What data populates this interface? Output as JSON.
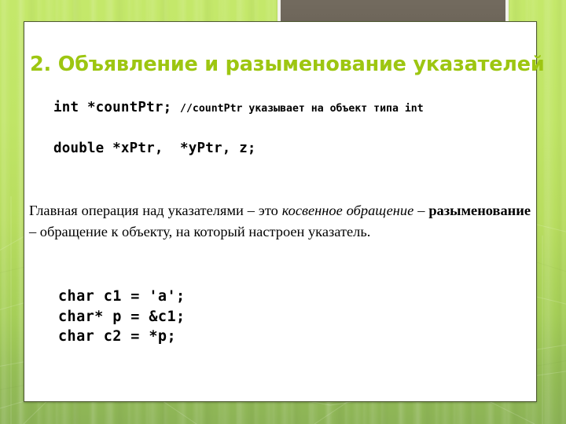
{
  "slide": {
    "title": "2. Объявление и разыменование указателей",
    "title_color": "#9dc611",
    "background_color": "#b8dd5f",
    "panel_color": "#ffffff",
    "panel_border_color": "#4f5a32",
    "photo_block_color": "#6f675b",
    "photo_frame_color": "#f2f2ec"
  },
  "code_top": {
    "line1_code": "int *countPtr; ",
    "line1_comment": "//countPtr указывает на объект типа int",
    "line2": "double *xPtr,  *yPtr, z;"
  },
  "paragraph": {
    "part1": "Главная операция над указателями – это ",
    "italic1": "косвенное обращение",
    "part2": " – ",
    "bold1": "разыменование",
    "part3": " – обращение к объекту, на который настроен указатель."
  },
  "code_bottom": {
    "line1": "char c1 = 'a';",
    "line2": "char* p = &c1;",
    "line3": "char c2 = *p;"
  }
}
